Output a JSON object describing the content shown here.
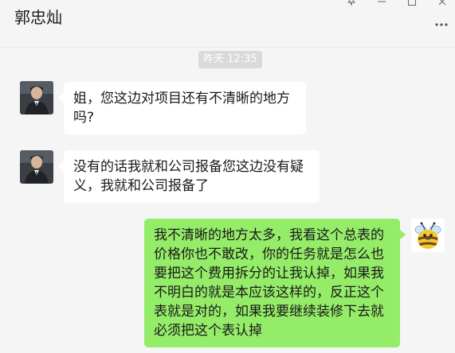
{
  "header": {
    "title": "郭忠灿"
  },
  "timestamp": "昨天 12:35",
  "messages": [
    {
      "sender": "contact",
      "text": "姐，您这边对项目还有不清晰的地方吗?"
    },
    {
      "sender": "contact",
      "text": "没有的话我就和公司报备您这边没有疑义，我就和公司报备了"
    },
    {
      "sender": "self",
      "text": "我不清晰的地方太多，我看这个总表的价格你也不敢改，你的任务就是怎么也要把这个费用拆分的让我认掉，如果我不明白的就是本应该这样的，反正这个表就是对的，如果我要继续装修下去就必须把这个表认掉"
    }
  ],
  "colors": {
    "background": "#f5f5f5",
    "self_bubble": "#95ec69",
    "contact_bubble": "#ffffff",
    "timestamp_bg": "#dadada"
  }
}
